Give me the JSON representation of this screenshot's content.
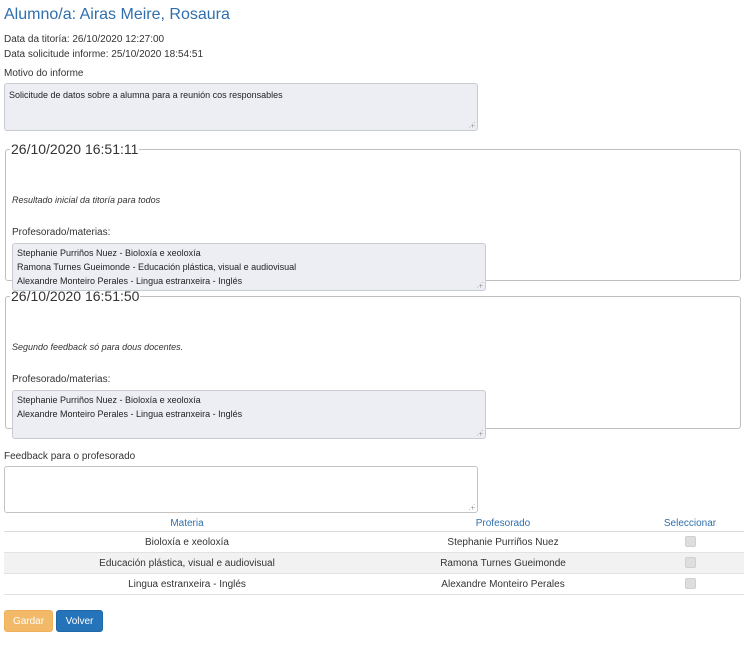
{
  "header": {
    "title": "Alumno/a: Airas Meire, Rosaura",
    "tutoring_date": "Data da titoría: 26/10/2020 12:27:00",
    "request_date": "Data solicitude informe: 25/10/2020 18:54:51"
  },
  "report": {
    "reason_label": "Motivo do informe",
    "reason_text": "Solicitude de datos sobre a alumna para a reunión cos responsables"
  },
  "entries": [
    {
      "timestamp": "26/10/2020 16:51:11",
      "comment": "Resultado inicial da titoría para todos",
      "teachers_label": "Profesorado/materias:",
      "teachers": [
        "Stephanie Purriños Nuez - Bioloxía e xeoloxía",
        "Ramona Turnes Gueimonde - Educación plástica, visual e audiovisual",
        "Alexandre Monteiro Perales - Lingua estranxeira - Inglés"
      ]
    },
    {
      "timestamp": "26/10/2020 16:51:50",
      "comment": "Segundo feedback só para dous docentes.",
      "teachers_label": "Profesorado/materias:",
      "teachers": [
        "Stephanie Purriños Nuez - Bioloxía e xeoloxía",
        "Alexandre Monteiro Perales - Lingua estranxeira - Inglés"
      ]
    }
  ],
  "feedback": {
    "label": "Feedback para o profesorado",
    "value": ""
  },
  "table": {
    "headers": [
      "Materia",
      "Profesorado",
      "Seleccionar"
    ],
    "rows": [
      {
        "subject": "Bioloxía e xeoloxía",
        "teacher": "Stephanie Purriños Nuez",
        "selected": false
      },
      {
        "subject": "Educación plástica, visual e audiovisual",
        "teacher": "Ramona Turnes Gueimonde",
        "selected": false
      },
      {
        "subject": "Lingua estranxeira - Inglés",
        "teacher": "Alexandre Monteiro Perales",
        "selected": false
      }
    ]
  },
  "buttons": {
    "save_label": "Gardar",
    "back_label": "Volver"
  },
  "colors": {
    "title": "#2f6fad",
    "save_button": "#f0ad4e",
    "back_button": "#2574b9",
    "readonly_field": "#eceef4"
  }
}
